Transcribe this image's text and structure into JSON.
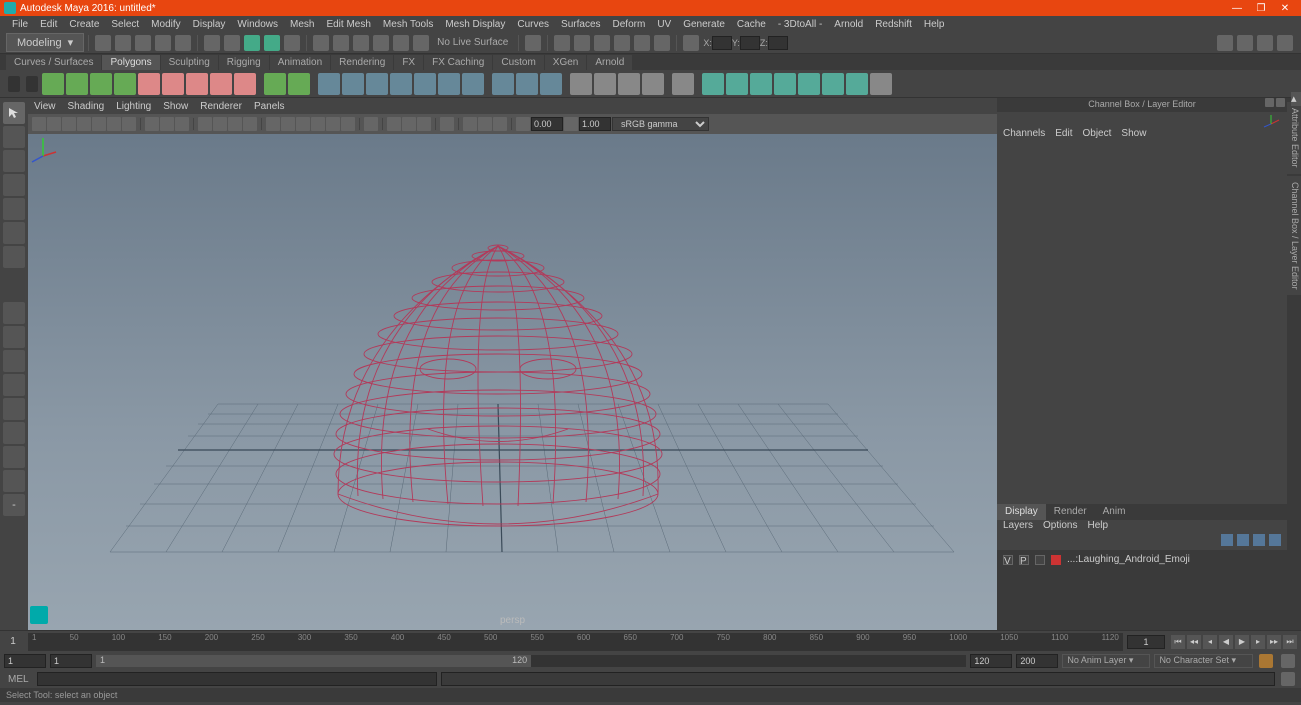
{
  "titlebar": {
    "title": "Autodesk Maya 2016: untitled*"
  },
  "menubar": [
    "File",
    "Edit",
    "Create",
    "Select",
    "Modify",
    "Display",
    "Windows",
    "Mesh",
    "Edit Mesh",
    "Mesh Tools",
    "Mesh Display",
    "Curves",
    "Surfaces",
    "Deform",
    "UV",
    "Generate",
    "Cache",
    "- 3DtoAll -",
    "Arnold",
    "Redshift",
    "Help"
  ],
  "toolbar": {
    "mode": "Modeling",
    "noLive": "No Live Surface",
    "coords": {
      "x": "X:",
      "y": "Y:",
      "z": "Z:"
    }
  },
  "shelftabs": [
    "Curves / Surfaces",
    "Polygons",
    "Sculpting",
    "Rigging",
    "Animation",
    "Rendering",
    "FX",
    "FX Caching",
    "Custom",
    "XGen",
    "Arnold"
  ],
  "shelfActive": 1,
  "viewportMenus": [
    "View",
    "Shading",
    "Lighting",
    "Show",
    "Renderer",
    "Panels"
  ],
  "vptoolbar": {
    "f1": "0.00",
    "f2": "1.00",
    "colorspace": "sRGB gamma"
  },
  "viewportLabel": "persp",
  "channelbox": {
    "header": "Channel Box / Layer Editor",
    "menus": [
      "Channels",
      "Edit",
      "Object",
      "Show"
    ]
  },
  "layertabs": [
    "Display",
    "Render",
    "Anim"
  ],
  "layertabActive": 0,
  "layermenus": [
    "Layers",
    "Options",
    "Help"
  ],
  "layerrow": {
    "v": "V",
    "p": "P",
    "name": "...:Laughing_Android_Emoji"
  },
  "sidetabs": [
    "Attribute Editor",
    "Channel Box / Layer Editor"
  ],
  "timeslider": {
    "start": "1",
    "ticks": [
      "1",
      "50",
      "100",
      "150",
      "200",
      "250",
      "300",
      "350",
      "400",
      "450",
      "500",
      "550",
      "600",
      "650",
      "700",
      "750",
      "800",
      "850",
      "900",
      "950",
      "1000",
      "1050",
      "1100",
      "1120"
    ],
    "end": "1"
  },
  "rangeslider": {
    "a": "1",
    "b": "1",
    "c": "1",
    "d": "120",
    "e": "120",
    "f": "200",
    "animlayer": "No Anim Layer",
    "charset": "No Character Set"
  },
  "cmdline": {
    "label": "MEL"
  },
  "helpline": "Select Tool: select an object"
}
